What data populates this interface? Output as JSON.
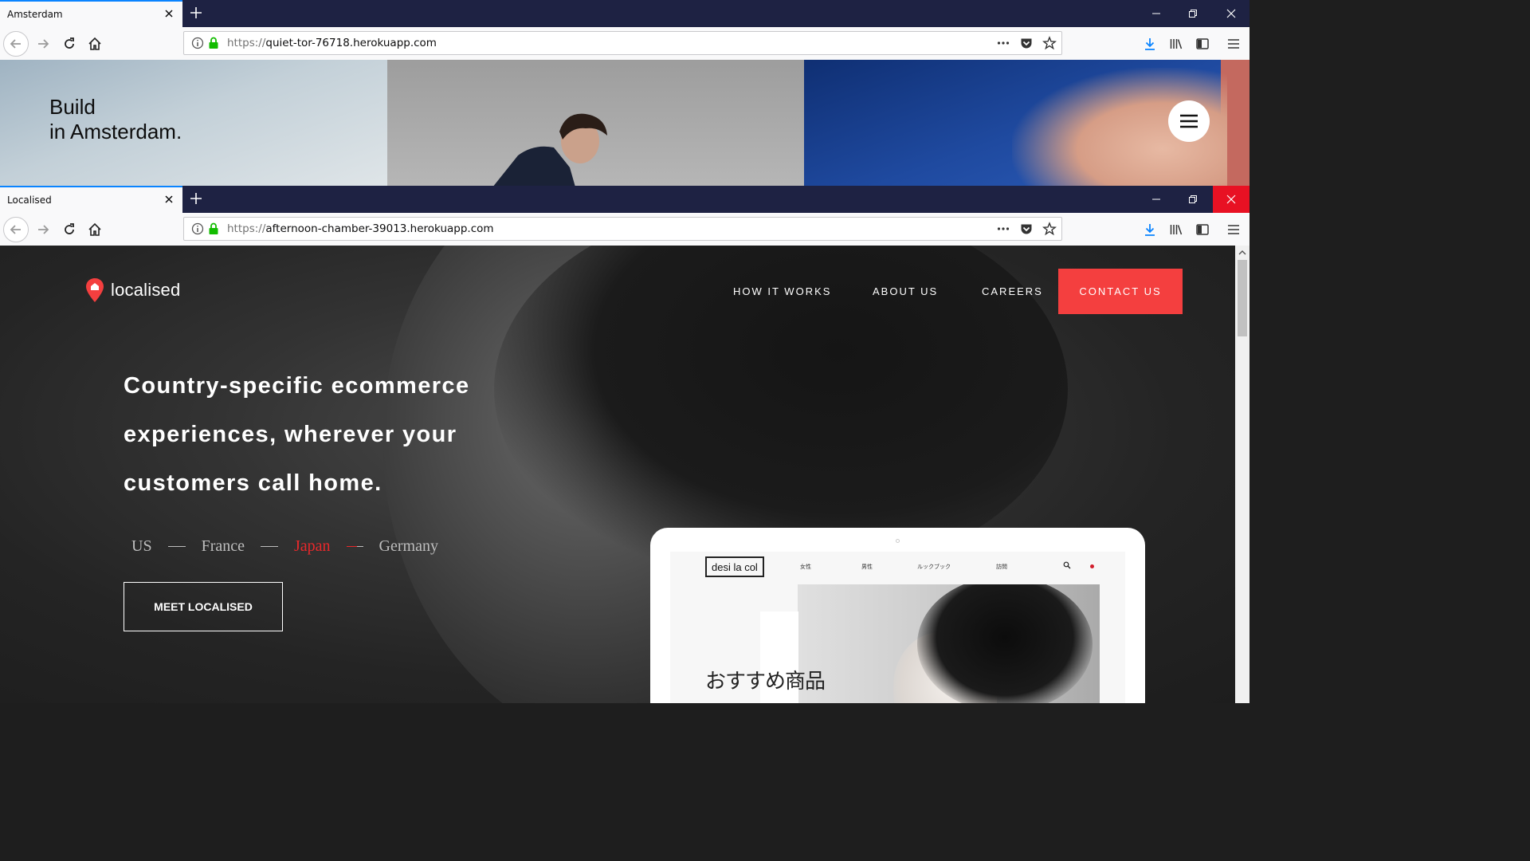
{
  "top_window": {
    "tab": {
      "title": "Amsterdam"
    },
    "url": {
      "protocol": "https://",
      "host": "quiet-tor-76718.herokuapp.com"
    },
    "page": {
      "title_line1": "Build",
      "title_line2": "in Amsterdam."
    }
  },
  "bottom_window": {
    "tab": {
      "title": "Localised"
    },
    "url": {
      "protocol": "https://",
      "host": "afternoon-chamber-39013.herokuapp.com"
    },
    "page": {
      "logo": "localised",
      "nav": [
        "HOW IT WORKS",
        "ABOUT US",
        "CAREERS"
      ],
      "contact": "CONTACT US",
      "hero": [
        "Country-specific ecommerce",
        "experiences, wherever your",
        "customers call home."
      ],
      "countries": [
        "US",
        "France",
        "Japan",
        "Germany"
      ],
      "active_country": "Japan",
      "cta": "MEET LOCALISED",
      "tablet": {
        "site_logo": "desi la col",
        "site_nav": [
          "女性",
          "男性",
          "ルックブック",
          "訪問"
        ],
        "headline": "おすすめ商品"
      }
    }
  },
  "colors": {
    "accent": "#f43f3f",
    "active_country": "#e8282b",
    "tabbar": "#1e2243",
    "focus": "#0a84ff"
  }
}
